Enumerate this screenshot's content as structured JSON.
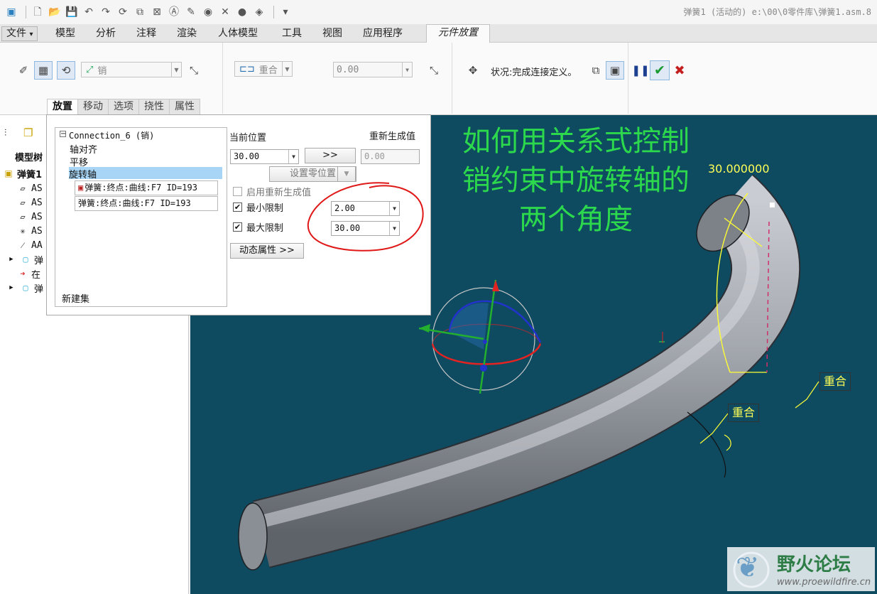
{
  "window": {
    "title": "弹簧1 (活动的) e:\\00\\0零件库\\弹簧1.asm.8"
  },
  "ribbon_tabs": [
    {
      "label": "文件",
      "dropdown": "▾"
    },
    {
      "label": "模型"
    },
    {
      "label": "分析"
    },
    {
      "label": "注释"
    },
    {
      "label": "渲染"
    },
    {
      "label": "人体模型"
    },
    {
      "label": "工具"
    },
    {
      "label": "视图"
    },
    {
      "label": "应用程序"
    },
    {
      "label": "元件放置"
    }
  ],
  "ribbon": {
    "connection_type": "销",
    "constraint_type": "重合",
    "offset_value": "0.00",
    "status": "状况:完成连接定义。"
  },
  "sub_tabs": [
    "放置",
    "移动",
    "选项",
    "挠性",
    "属性"
  ],
  "model_tree": {
    "header": "模型树",
    "root": "弹簧1",
    "rows": [
      "AS",
      "AS",
      "AS",
      "AS",
      "AA",
      "弹",
      "在",
      "弹"
    ]
  },
  "placement": {
    "connection": "Connection_6 (销)",
    "items": [
      "轴对齐",
      "平移",
      "旋转轴"
    ],
    "refs": [
      "弹簧:终点:曲线:F7 ID=193",
      "弹簧:终点:曲线:F7 ID=193"
    ],
    "new_set": "新建集",
    "current_position_label": "当前位置",
    "regen_value_label": "重新生成值",
    "current_position": "30.00",
    "go_button": ">>",
    "regen_value": "0.00",
    "set_zero_button": "设置零位置",
    "enable_regen_label": "启用重新生成值",
    "min_limit_label": "最小限制",
    "min_limit": "2.00",
    "max_limit_label": "最大限制",
    "max_limit": "30.00",
    "dynamic_props_button": "动态属性 >>"
  },
  "viewport": {
    "annotation": "如何用关系式控制销约束中旋转轴的两个角度",
    "angle_dim": "30.000000",
    "tags": [
      "重合",
      "重合"
    ],
    "background": "#0e4b61",
    "annotation_color": "#2cd84c"
  },
  "watermark": {
    "title": "野火论坛",
    "url": "www.proewildfire.cn"
  }
}
